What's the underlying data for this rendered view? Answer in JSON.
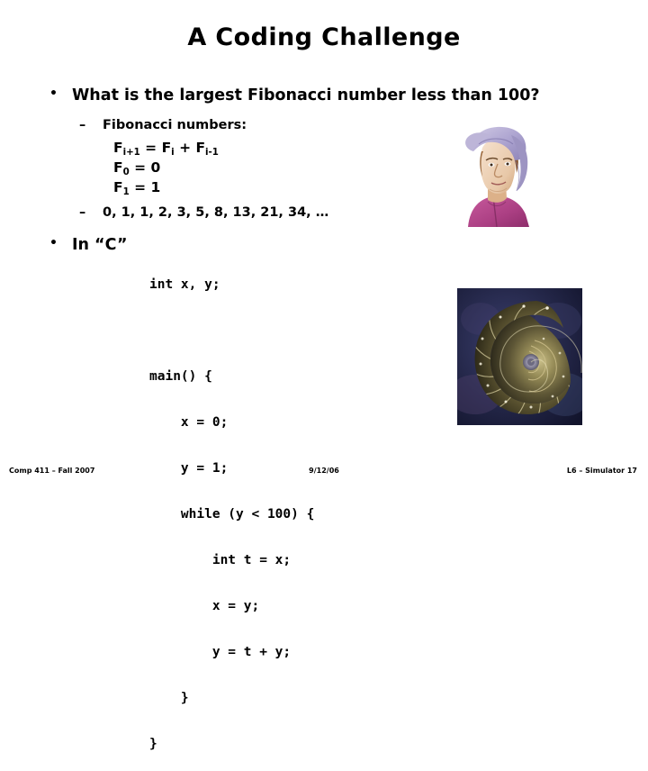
{
  "slide": {
    "title": "A Coding Challenge",
    "footer": {
      "left": "Comp 411 – Fall 2007",
      "center": "9/12/06",
      "right": "L6 – Simulator   17"
    }
  },
  "bullets": {
    "b1": {
      "marker": "•",
      "text": "What is the largest Fibonacci number less than 100?"
    },
    "b1_sub1": {
      "marker": "–",
      "text": "Fibonacci numbers:"
    },
    "b1_sub2": {
      "marker": "–",
      "text": "0, 1, 1, 2, 3, 5, 8, 13, 21, 34, …"
    },
    "b2": {
      "marker": "•",
      "text": "In “C”"
    }
  },
  "formulas": {
    "recurrence": {
      "f_left": "F",
      "sub_left": "i+1",
      "eq": " = ",
      "f_mid": "F",
      "sub_mid": "i",
      "plus": " + ",
      "f_right": "F",
      "sub_right": "i-1"
    },
    "base0": {
      "f": "F",
      "sub": "0",
      "rest": " = 0"
    },
    "base1": {
      "f": "F",
      "sub": "1",
      "rest": " = 1"
    }
  },
  "code": {
    "line1": "int x, y;",
    "line2": "main() {",
    "line3": "    x = 0;",
    "line4": "    y = 1;",
    "line5": "    while (y < 100) {",
    "line6": "        int t = x;",
    "line7": "        x = y;",
    "line8": "        y = t + y;",
    "line9": "    }",
    "line10": "}"
  },
  "images": {
    "portrait_alt": "Fibonacci portrait",
    "nautilus_alt": "Nautilus shell spiral"
  },
  "colors": {
    "background": "#ffffff",
    "text": "#000000",
    "portrait_hat": "#b0a8d0",
    "portrait_robe": "#b94a8c",
    "nautilus_bg": "#191c3c",
    "nautilus_shell": "#6f6540"
  }
}
